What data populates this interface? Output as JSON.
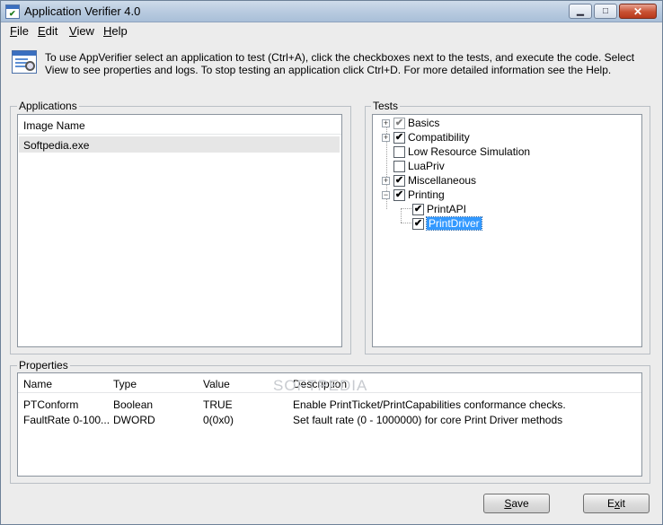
{
  "window": {
    "title": "Application Verifier 4.0"
  },
  "menu": {
    "file": "ile",
    "file_key": "F",
    "edit": "dit",
    "edit_key": "E",
    "view": "iew",
    "view_key": "V",
    "help": "elp",
    "help_key": "H"
  },
  "info": {
    "text": "To use AppVerifier select an application to test (Ctrl+A), click the checkboxes next to the tests, and execute the code. Select View to see properties and logs. To stop testing an application click Ctrl+D. For more detailed information see the Help."
  },
  "applications": {
    "label": "Applications",
    "header": "Image Name",
    "items": [
      "Softpedia.exe"
    ]
  },
  "tests": {
    "label": "Tests",
    "items": [
      {
        "label": "Basics",
        "checked": true,
        "grey": true,
        "expander": "+"
      },
      {
        "label": "Compatibility",
        "checked": true,
        "expander": "+"
      },
      {
        "label": "Low Resource Simulation",
        "checked": false,
        "expander": ""
      },
      {
        "label": "LuaPriv",
        "checked": false,
        "expander": ""
      },
      {
        "label": "Miscellaneous",
        "checked": true,
        "expander": "+"
      },
      {
        "label": "Printing",
        "checked": true,
        "expander": "−"
      },
      {
        "label": "PrintAPI",
        "checked": true,
        "child": true
      },
      {
        "label": "PrintDriver",
        "checked": true,
        "child": true,
        "selected": true
      }
    ]
  },
  "properties": {
    "label": "Properties",
    "columns": [
      "Name",
      "Type",
      "Value",
      "Description"
    ],
    "rows": [
      [
        "PTConform",
        "Boolean",
        "TRUE",
        "Enable PrintTicket/PrintCapabilities conformance checks."
      ],
      [
        "FaultRate 0-100...",
        "DWORD",
        "0(0x0)",
        "Set fault rate (0 - 1000000) for core Print Driver methods"
      ]
    ],
    "watermark": "SOFTPEDIA"
  },
  "buttons": {
    "save_key": "S",
    "save_rest": "ave",
    "exit_key": "x",
    "exit_pre": "E",
    "exit_rest": "it"
  }
}
